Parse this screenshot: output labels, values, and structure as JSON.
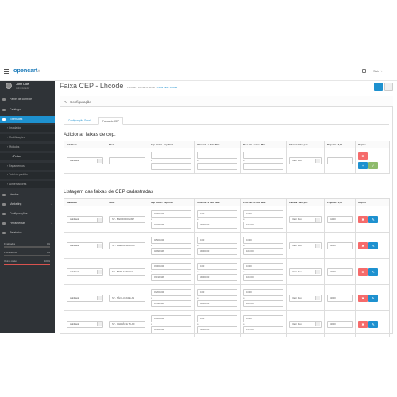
{
  "header": {
    "logo_text": "opencart",
    "logo_cart": "⌂",
    "exit_label": "Sair"
  },
  "user": {
    "name": "John Doe",
    "role": "Administrador"
  },
  "sidebar": {
    "items": [
      {
        "label": "Painel de controle"
      },
      {
        "label": "Catálogo"
      },
      {
        "label": "Extensões"
      },
      {
        "label": "Instalador"
      },
      {
        "label": "Modificações"
      },
      {
        "label": "Módulos"
      },
      {
        "label": "Fretes"
      },
      {
        "label": "Pagamentos"
      },
      {
        "label": "Total do pedido"
      },
      {
        "label": "Alimentadores"
      },
      {
        "label": "Vendas"
      },
      {
        "label": "Marketing"
      },
      {
        "label": "Configurações"
      },
      {
        "label": "Ferramentas"
      },
      {
        "label": "Relatórios"
      }
    ],
    "stats": [
      {
        "label": "Finalizados",
        "value": "0%",
        "fill": 0,
        "color": "#888888"
      },
      {
        "label": "Processando",
        "value": "0%",
        "fill": 0,
        "color": "#888888"
      },
      {
        "label": "Outros status",
        "value": "100%",
        "fill": 1,
        "color": "#d9534f"
      }
    ]
  },
  "page": {
    "title": "Faixa CEP - Lhcode",
    "breadcrumb": [
      "Principal",
      "Formas de Envio",
      "Faixa CEP - Lhcode"
    ],
    "panel_title": "Configuração",
    "tabs": [
      "Configuração Geral",
      "Faixas de CEP"
    ]
  },
  "add_section": {
    "title": "Adicionar faixas de cep.",
    "headers": [
      "Habilitado",
      "Título",
      "Cep Inicial - Cep Final",
      "Valor mín. e Valor Máx.",
      "Peso mín. e Peso Máx.",
      "Calcular Valor por:",
      "Projeção - 0,00",
      "Opções"
    ],
    "row": {
      "enabled": "Habilitado",
      "calc": "Valor Fixo",
      "sep": "a"
    }
  },
  "list_section": {
    "title": "Listagem das faixas de CEP cadastradas",
    "headers": [
      "Habilitado",
      "Título",
      "Cep Inicial - Cep Final",
      "Valor mín. e Valor Máx.",
      "Peso mín. e Peso Máx.",
      "Calcular Valor por:",
      "Projeção - 0,00",
      "Opções"
    ],
    "rows": [
      {
        "enabled": "Habilitado",
        "title": "SP - BAIRRO DO LIMP",
        "cep_start": "02000-000",
        "cep_end": "02739-999",
        "val_min": "0.00",
        "val_max": "30000.00",
        "peso_min": "0.000",
        "peso_max": "100.000",
        "calc": "Valor Fixo",
        "proj": "44.00"
      },
      {
        "enabled": "Habilitado",
        "title": "SP - FREGUESIA DO C",
        "cep_start": "02500-000",
        "cep_end": "02999-999",
        "val_min": "0.00",
        "val_max": "30000.00",
        "peso_min": "0.000",
        "peso_max": "100.000",
        "calc": "Valor Fixo",
        "proj": "40.00"
      },
      {
        "enabled": "Habilitado",
        "title": "SP - BRAS E MOOCA",
        "cep_start": "03000-000",
        "cep_end": "03199-999",
        "val_min": "0.00",
        "val_max": "30000.00",
        "peso_min": "0.000",
        "peso_max": "100.000",
        "calc": "Valor Fixo",
        "proj": "40.00"
      },
      {
        "enabled": "Habilitado",
        "title": "SP - SÃO LUCAS E AN",
        "cep_start": "03200-000",
        "cep_end": "03599-999",
        "val_min": "0.00",
        "val_max": "30000.00",
        "peso_min": "0.000",
        "peso_max": "100.000",
        "calc": "Valor Fixo",
        "proj": "40.00"
      },
      {
        "enabled": "Habilitado",
        "title": "SP - CARRÃO E VILA F",
        "cep_start": "03300-000",
        "cep_end": "03499-999",
        "val_min": "0.00",
        "val_max": "30000.00",
        "peso_min": "0.000",
        "peso_max": "100.000",
        "calc": "Valor Fixo",
        "proj": "40.00"
      }
    ],
    "sep": "a"
  },
  "colors": {
    "primary": "#1e91cf",
    "danger": "#f56b6b",
    "success": "#8fbb6c",
    "sidebar": "#2f3337"
  },
  "icons": {
    "pencil": "✎",
    "trash": "✖",
    "plus": "+",
    "edit": "✎",
    "save": "✓"
  }
}
